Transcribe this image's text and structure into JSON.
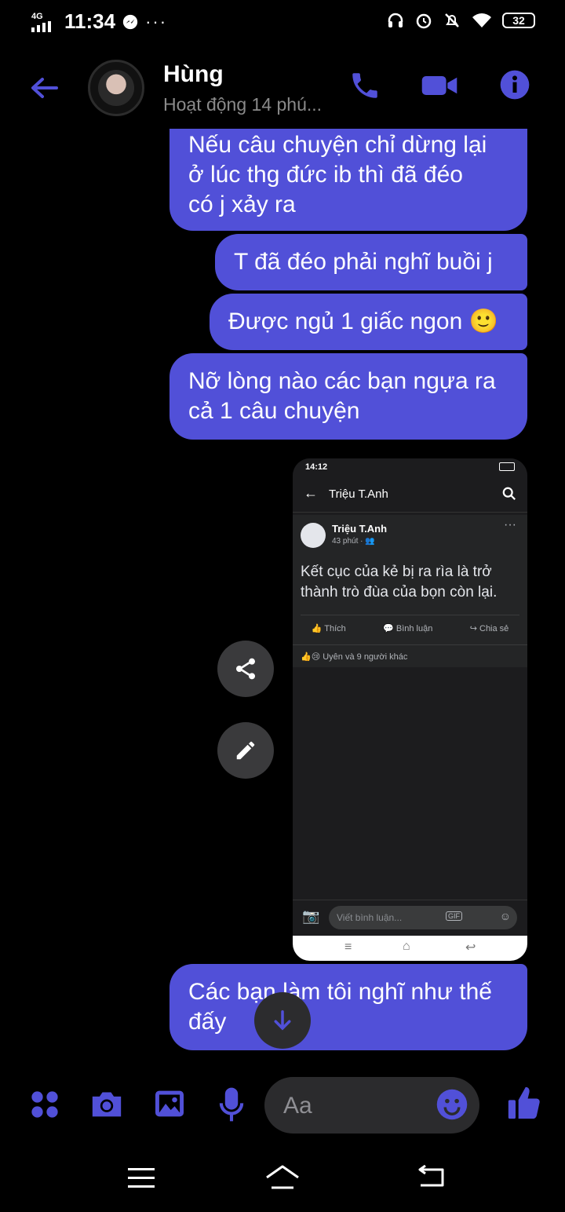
{
  "status_bar": {
    "network": "4G",
    "time": "11:34",
    "battery": "32"
  },
  "header": {
    "name": "Hùng",
    "status": "Hoạt động 14 phú..."
  },
  "messages": [
    {
      "lines": [
        "Nếu câu chuyện chỉ dừng lại",
        "ở lúc thg đức ib thì đã đéo",
        "có j xảy ra"
      ]
    },
    {
      "text": "T đã đéo phải nghĩ buồi j"
    },
    {
      "text": "Được ngủ 1 giấc ngon 🙂"
    },
    {
      "lines": [
        "Nỡ lòng nào các bạn ngựa ra",
        "cả 1 câu chuyện"
      ]
    },
    {
      "lines": [
        "Các bạn làm tôi nghĩ như thế",
        "đấy"
      ]
    }
  ],
  "shared_screenshot": {
    "time": "14:12",
    "profile_name": "Triệu T.Anh",
    "author": "Triệu T.Anh",
    "post_time": "43 phút · 👥",
    "post_lines": [
      "Kết cục của kẻ bị ra rìa là trở",
      "thành trò đùa của bọn còn lại."
    ],
    "actions": [
      "Thích",
      "Bình luận",
      "Chia sẻ"
    ],
    "reactions": "Uyên và 9 người khác",
    "comment_placeholder": "Viết bình luận...",
    "gif_label": "GIF"
  },
  "composer": {
    "placeholder": "Aa"
  },
  "colors": {
    "accent": "#5150d8",
    "background": "#000000",
    "input_bg": "#2b2b2d"
  },
  "icons": [
    "back-arrow-icon",
    "phone-icon",
    "video-icon",
    "info-icon",
    "share-icon",
    "edit-icon",
    "scroll-down-icon",
    "apps-icon",
    "camera-icon",
    "gallery-icon",
    "mic-icon",
    "emoji-icon",
    "like-icon",
    "menu-nav-icon",
    "home-nav-icon",
    "back-nav-icon"
  ]
}
